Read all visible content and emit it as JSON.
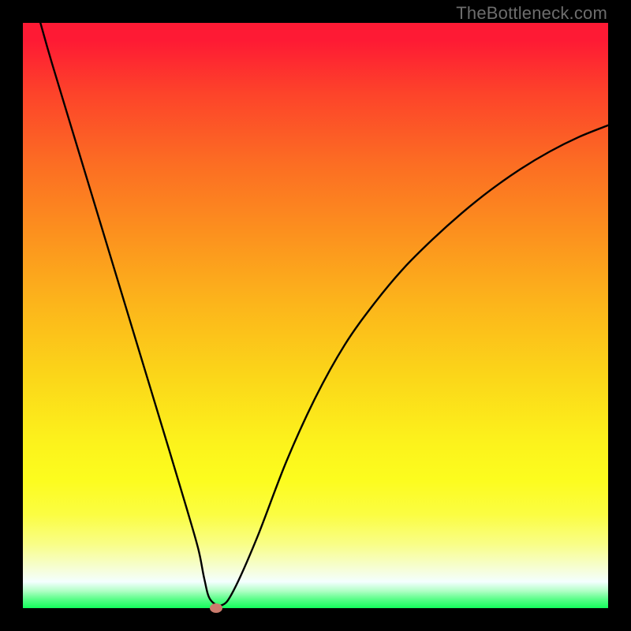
{
  "watermark": "TheBottleneck.com",
  "colors": {
    "background": "#000000",
    "curve": "#000000",
    "marker": "#cb7b6d"
  },
  "chart_data": {
    "type": "line",
    "title": "",
    "xlabel": "",
    "ylabel": "",
    "xlim": [
      0,
      100
    ],
    "ylim": [
      0,
      100
    ],
    "grid": false,
    "legend": false,
    "axes_visible": false,
    "series": [
      {
        "name": "bottleneck-curve",
        "x": [
          3,
          5,
          10,
          15,
          20,
          25,
          28,
          30,
          31,
          32,
          34,
          36,
          40,
          45,
          50,
          55,
          60,
          65,
          70,
          75,
          80,
          85,
          90,
          95,
          100
        ],
        "y": [
          100,
          93,
          76.5,
          60,
          43.5,
          27,
          17,
          10,
          5,
          1.5,
          0.5,
          3,
          12,
          25,
          36,
          45,
          52,
          58,
          63,
          67.5,
          71.5,
          75,
          78,
          80.5,
          82.5
        ]
      }
    ],
    "min_point": {
      "x": 33,
      "y": 0
    },
    "background_gradient": {
      "direction": "vertical",
      "stops": [
        {
          "pos": 0.0,
          "color": "#fe1a34"
        },
        {
          "pos": 0.5,
          "color": "#fcc01a"
        },
        {
          "pos": 0.78,
          "color": "#fcfc1e"
        },
        {
          "pos": 0.95,
          "color": "#f4ffff"
        },
        {
          "pos": 1.0,
          "color": "#13fe5c"
        }
      ]
    }
  }
}
